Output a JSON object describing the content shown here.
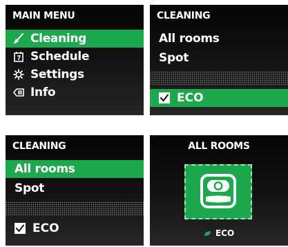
{
  "main_menu": {
    "title": "MAIN MENU",
    "items": [
      {
        "label": "Cleaning",
        "icon": "broom-icon",
        "selected": true
      },
      {
        "label": "Schedule",
        "icon": "calendar-icon",
        "selected": false
      },
      {
        "label": "Settings",
        "icon": "gear-icon",
        "selected": false
      },
      {
        "label": "Info",
        "icon": "info-icon",
        "selected": false
      }
    ]
  },
  "cleaning_eco": {
    "title": "CLEANING",
    "items": [
      "All rooms",
      "Spot"
    ],
    "eco_label": "ECO",
    "eco_checked": true
  },
  "cleaning_allrooms": {
    "title": "CLEANING",
    "items": [
      "All rooms",
      "Spot"
    ],
    "eco_label": "ECO",
    "eco_checked": true
  },
  "all_rooms": {
    "title": "ALL ROOMS",
    "robot_icon": "robot-vacuum-icon",
    "eco_label": "ECO",
    "leaf_icon": "leaf-icon"
  },
  "colors": {
    "accent": "#1ea84e",
    "screen_bg": "#111111",
    "text": "#ffffff"
  }
}
